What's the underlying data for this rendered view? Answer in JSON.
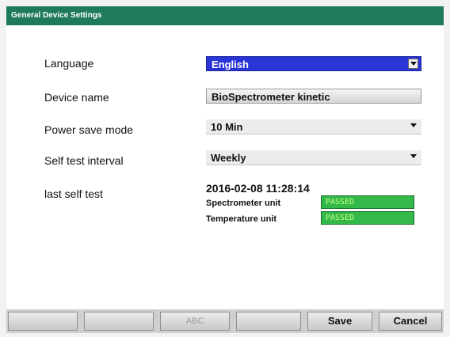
{
  "window": {
    "title": "General Device Settings"
  },
  "settings": {
    "language": {
      "label": "Language",
      "value": "English"
    },
    "device_name": {
      "label": "Device name",
      "value": "BioSpectrometer kinetic"
    },
    "power_save": {
      "label": "Power save mode",
      "value": "10 Min"
    },
    "self_test_interval": {
      "label": "Self test interval",
      "value": "Weekly"
    },
    "last_self_test": {
      "label": "last self test",
      "datetime": "2016-02-08 11:28:14",
      "units": [
        {
          "name": "Spectrometer unit",
          "status": "PASSED"
        },
        {
          "name": "Temperature unit",
          "status": "PASSED"
        }
      ]
    }
  },
  "softkeys": {
    "key1": "",
    "key2": "",
    "key3": "ABC",
    "key4": "",
    "save": "Save",
    "cancel": "Cancel"
  },
  "colors": {
    "titlebar": "#1f7a5a",
    "selected": "#2a35d6",
    "passed": "#33b94a"
  }
}
